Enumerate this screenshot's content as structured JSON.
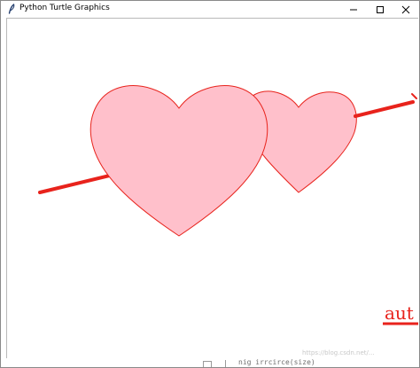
{
  "window": {
    "title": "Python Turtle Graphics",
    "icons": {
      "app": "turtle-feather-icon",
      "minimize": "minimize-icon",
      "maximize": "maximize-icon",
      "close": "close-icon"
    }
  },
  "canvas": {
    "background": "#ffffff",
    "heart_fill": "#ffc0cb",
    "heart_stroke": "#e8231c",
    "arrow_color": "#e8231c",
    "written_text": "aut"
  },
  "background_window": {
    "code_text": "nig irrcirce(size)"
  },
  "watermark": "https://blog.csdn.net/..."
}
